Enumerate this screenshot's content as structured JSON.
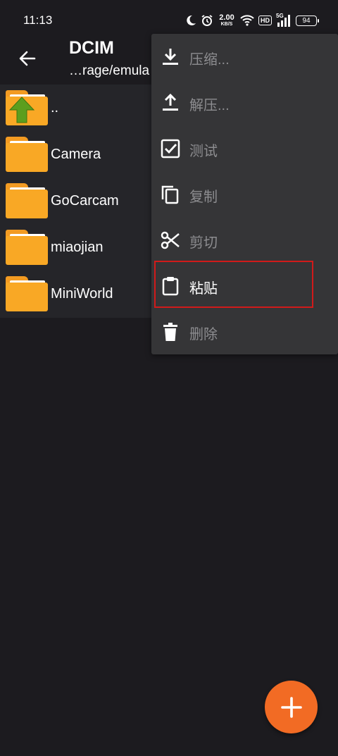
{
  "status_bar": {
    "time": "11:13",
    "net_speed_value": "2.00",
    "net_speed_unit": "KB/S",
    "hd_label": "HD",
    "signal_label": "5G",
    "battery_level": "94"
  },
  "app_bar": {
    "title": "DCIM",
    "subtitle": "…rage/emula"
  },
  "files": [
    {
      "name": "..",
      "icon": "folder-up-icon"
    },
    {
      "name": "Camera",
      "icon": "folder-icon"
    },
    {
      "name": "GoCarcam",
      "icon": "folder-icon"
    },
    {
      "name": "miaojian",
      "icon": "folder-icon"
    },
    {
      "name": "MiniWorld",
      "icon": "folder-icon"
    }
  ],
  "menu": {
    "items": [
      {
        "label": "压缩...",
        "icon": "download-icon",
        "enabled": false
      },
      {
        "label": "解压...",
        "icon": "upload-icon",
        "enabled": false
      },
      {
        "label": "测试",
        "icon": "checkbox-icon",
        "enabled": false
      },
      {
        "label": "复制",
        "icon": "copy-icon",
        "enabled": false
      },
      {
        "label": "剪切",
        "icon": "scissors-icon",
        "enabled": false
      },
      {
        "label": "粘贴",
        "icon": "clipboard-icon",
        "enabled": true
      },
      {
        "label": "删除",
        "icon": "trash-icon",
        "enabled": false
      }
    ],
    "highlighted_item": "粘贴"
  },
  "fab": {
    "icon": "plus-icon"
  },
  "colors": {
    "background": "#1c1b1f",
    "list_background": "#252529",
    "menu_background": "#353537",
    "folder": "#f9a825",
    "fab": "#f26b24",
    "highlight": "#d11a1a",
    "disabled_text": "#8d8d90"
  }
}
